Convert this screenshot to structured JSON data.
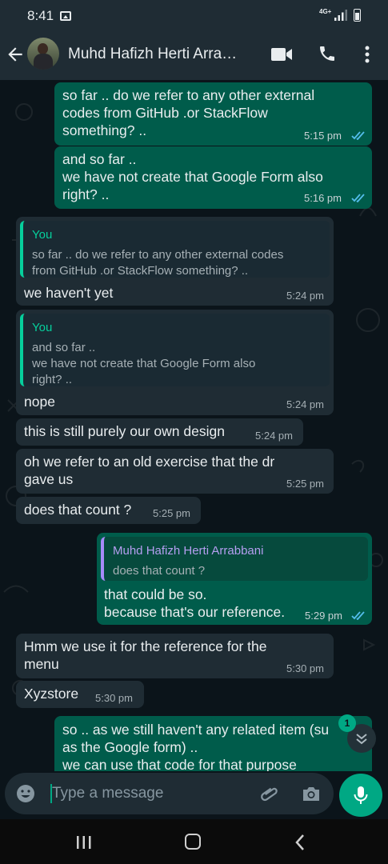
{
  "status_bar": {
    "time": "8:41",
    "network": "4G+",
    "icons": [
      "gallery-icon",
      "signal-icon",
      "battery-icon"
    ]
  },
  "header": {
    "contact_name": "Muhd Hafizh Herti Arra…",
    "icons": [
      "back-arrow-icon",
      "avatar",
      "video-call-icon",
      "phone-icon",
      "more-vertical-icon"
    ]
  },
  "messages": [
    {
      "dir": "out",
      "lines": [
        "so far .. do we refer to any other external",
        "codes from GitHub .or StackFlow",
        "something? .."
      ],
      "time": "5:15 pm",
      "status": "read"
    },
    {
      "dir": "out",
      "lines": [
        "and so far ..",
        "we have not create that Google Form also",
        "right? .."
      ],
      "time": "5:16 pm",
      "status": "read"
    },
    {
      "dir": "in",
      "quote": {
        "name": "You",
        "lines": [
          "so far .. do we refer to any other external codes",
          "from GitHub .or StackFlow something? .."
        ]
      },
      "lines": [
        "we haven't yet"
      ],
      "time": "5:24 pm"
    },
    {
      "dir": "in",
      "quote": {
        "name": "You",
        "lines": [
          "and so far ..",
          "we have not create that Google Form also",
          "right? .."
        ]
      },
      "lines": [
        "nope"
      ],
      "time": "5:24 pm"
    },
    {
      "dir": "in",
      "lines": [
        "this is still purely our own design"
      ],
      "time": "5:24 pm"
    },
    {
      "dir": "in",
      "lines": [
        "oh we refer to an old exercise that the dr",
        "gave us"
      ],
      "time": "5:25 pm"
    },
    {
      "dir": "in",
      "lines": [
        "does that count ?"
      ],
      "time": "5:25 pm"
    },
    {
      "dir": "out",
      "quote": {
        "name": "Muhd Hafizh Herti Arrabbani",
        "lines": [
          "does that count ?"
        ]
      },
      "lines": [
        "that could be so.",
        "because that's our reference."
      ],
      "time": "5:29 pm",
      "status": "read"
    },
    {
      "dir": "in",
      "lines": [
        "Hmm we use it for the reference for the",
        "menu"
      ],
      "time": "5:30 pm"
    },
    {
      "dir": "in",
      "lines": [
        "Xyzstore"
      ],
      "time": "5:30 pm"
    },
    {
      "dir": "out",
      "lines": [
        "so .. as we still haven't any related item (su",
        "as the Google form) ..",
        "we can use that code for that purpose"
      ]
    }
  ],
  "scroll_down": {
    "badge_count": "1",
    "icon": "double-chevron-down-icon"
  },
  "composer": {
    "placeholder": "Type a message",
    "icons": [
      "emoji-icon",
      "attach-icon",
      "camera-icon",
      "mic-icon"
    ]
  },
  "nav_bar": {
    "icons": [
      "recent-apps-icon",
      "home-icon",
      "back-icon"
    ]
  },
  "colors": {
    "bar_bg": "#1f2c34",
    "chat_bg": "#0b141a",
    "outgoing_bubble": "#005c4b",
    "incoming_bubble": "#1f2c34",
    "accent": "#00a884",
    "read_ticks": "#53bdeb"
  }
}
